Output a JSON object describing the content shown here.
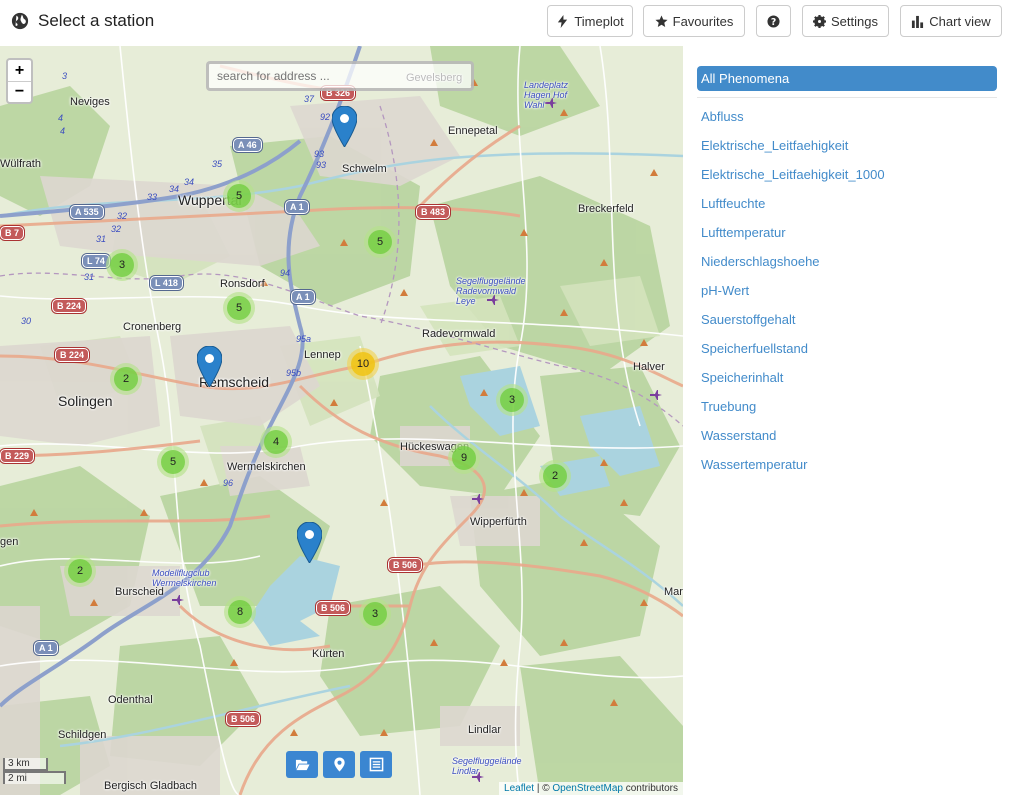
{
  "header": {
    "title": "Select a station",
    "buttons": {
      "timeplot": "Timeplot",
      "favourites": "Favourites",
      "settings": "Settings",
      "chart_view": "Chart view"
    }
  },
  "map": {
    "search_placeholder": "search for address ...",
    "zoom_in": "+",
    "zoom_out": "−",
    "scale": {
      "km": "3 km",
      "mi": "2 mi"
    },
    "attribution": {
      "leaflet": "Leaflet",
      "sep": " | © ",
      "osm": "OpenStreetMap",
      "suffix": " contributors"
    },
    "clusters": [
      "5",
      "5",
      "3",
      "5",
      "10",
      "2",
      "3",
      "4",
      "5",
      "9",
      "2",
      "2",
      "8",
      "3"
    ],
    "places": {
      "neviges": "Neviges",
      "wulfrath": "Wülfrath",
      "wuppertal": "Wuppertal",
      "gevelsberg": "Gevelsberg",
      "ennepetal": "Ennepetal",
      "schwelm": "Schwelm",
      "breckerfeld": "Breckerfeld",
      "ronsdorf": "Ronsdorf",
      "cronenberg": "Cronenberg",
      "radevormwald": "Radevormwald",
      "lennep": "Lennep",
      "remscheid": "Remscheid",
      "solingen": "Solingen",
      "halver": "Halver",
      "hueckeswagen": "Hückeswagen",
      "wermelskirchen": "Wermelskirchen",
      "wipperfuerth": "Wipperfürth",
      "burscheid": "Burscheid",
      "kuerten": "Kürten",
      "odenthal": "Odenthal",
      "schildgen": "Schildgen",
      "lindlar": "Lindlar",
      "bergisch_gladbach": "Bergisch Gladbach",
      "mar": "Mar",
      "gen": "gen"
    },
    "airfields": {
      "hagen": "Landeplatz Hagen Hof Wahl",
      "radevormwald": "Segelfluggelände Radevormwald Leye",
      "wermelskirchen": "Modellflugclub Wermelskirchen",
      "lindlar": "Segelfluggelände Lindlar"
    },
    "roads": {
      "b326": "B 326",
      "a46": "A 46",
      "a535": "A 535",
      "b7": "B 7",
      "a1_north": "A 1",
      "b483": "B 483",
      "l74": "L 74",
      "l418": "L 418",
      "a1_mid": "A 1",
      "b224_top": "B 224",
      "b224_bottom": "B 224",
      "b229": "B 229",
      "b506_east": "B 506",
      "b506_mid": "B 506",
      "a1_south": "A 1",
      "b506_south": "B 506"
    },
    "junctions": [
      "37",
      "92",
      "93",
      "93",
      "35",
      "34",
      "34",
      "33",
      "32",
      "32",
      "31",
      "31",
      "94",
      "95a",
      "95b",
      "96",
      "30",
      "3",
      "4",
      "4"
    ]
  },
  "sidebar": {
    "all_phenomena": "All Phenomena",
    "phenomena": [
      "Abfluss",
      "Elektrische_Leitfaehigkeit",
      "Elektrische_Leitfaehigkeit_1000",
      "Luftfeuchte",
      "Lufttemperatur",
      "Niederschlagshoehe",
      "pH-Wert",
      "Sauerstoffgehalt",
      "Speicherfuellstand",
      "Speicherinhalt",
      "Truebung",
      "Wasserstand",
      "Wassertemperatur"
    ]
  },
  "colors": {
    "accent": "#428bca",
    "marker": "#2a81cb",
    "cluster_small": "#6ecc39",
    "cluster_medium": "#f0c20c"
  }
}
